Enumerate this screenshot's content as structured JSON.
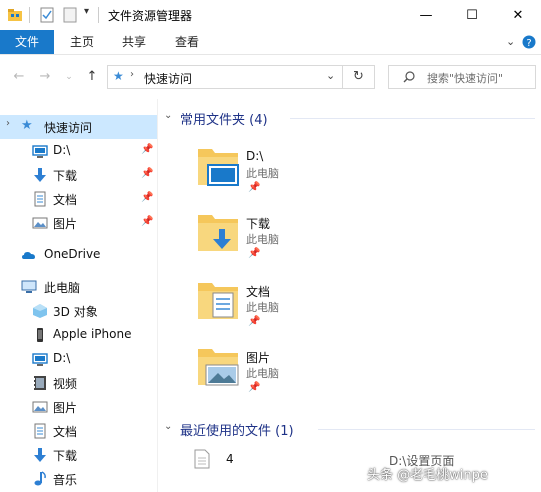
{
  "window": {
    "title": "文件资源管理器",
    "minimize_glyph": "—",
    "maximize_glyph": "☐",
    "close_glyph": "✕"
  },
  "ribbon": {
    "tabs": [
      {
        "label": "文件",
        "active": true
      },
      {
        "label": "主页"
      },
      {
        "label": "共享"
      },
      {
        "label": "查看"
      }
    ],
    "accent": "#1979ca"
  },
  "address": {
    "location": "快速访问",
    "search_placeholder": "搜索\"快速访问\""
  },
  "nav": {
    "quick_access": "快速访问",
    "pinned": [
      {
        "label": "D:\\",
        "icon": "drive-icon"
      },
      {
        "label": "下载",
        "icon": "download-icon"
      },
      {
        "label": "文档",
        "icon": "document-icon"
      },
      {
        "label": "图片",
        "icon": "picture-icon"
      }
    ],
    "onedrive": "OneDrive",
    "this_pc": "此电脑",
    "pc_items": [
      {
        "label": "3D 对象",
        "icon": "3d-objects-icon"
      },
      {
        "label": "Apple iPhone",
        "icon": "phone-icon"
      },
      {
        "label": "D:\\",
        "icon": "drive-icon"
      },
      {
        "label": "视频",
        "icon": "video-icon"
      },
      {
        "label": "图片",
        "icon": "picture-icon"
      },
      {
        "label": "文档",
        "icon": "document-icon"
      },
      {
        "label": "下载",
        "icon": "download-icon"
      },
      {
        "label": "音乐",
        "icon": "music-icon"
      }
    ]
  },
  "content": {
    "frequent_header": "常用文件夹 (4)",
    "folders": [
      {
        "name": "D:\\",
        "location": "此电脑"
      },
      {
        "name": "下载",
        "location": "此电脑"
      },
      {
        "name": "文档",
        "location": "此电脑"
      },
      {
        "name": "图片",
        "location": "此电脑"
      }
    ],
    "recent_header": "最近使用的文件 (1)",
    "recent_files": [
      {
        "name": "4",
        "path": "D:\\设置页面"
      }
    ]
  },
  "watermark": "头条 @老毛桃winpe"
}
